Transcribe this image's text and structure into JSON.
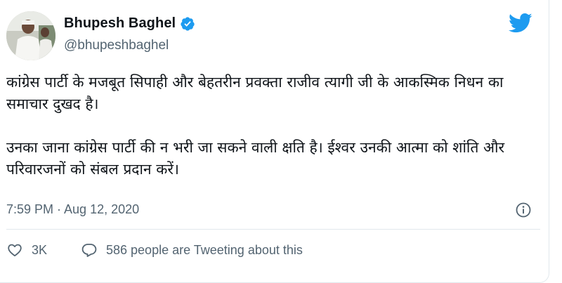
{
  "user": {
    "display_name": "Bhupesh Baghel",
    "handle": "@bhupeshbaghel",
    "verified": true
  },
  "tweet": {
    "paragraphs": [
      "कांग्रेस पार्टी के मजबूत सिपाही और बेहतरीन प्रवक्ता राजीव त्यागी जी के आकस्मिक निधन का समाचार दुखद है।",
      "उनका जाना कांग्रेस पार्टी की न भरी जा सकने वाली क्षति है। ईश्वर उनकी आत्मा को शांति और परिवारजनों को संबल प्रदान करें।"
    ],
    "timestamp": "7:59 PM · Aug 12, 2020"
  },
  "actions": {
    "like_count": "3K",
    "conversation_text": "586 people are Tweeting about this"
  },
  "icons": {
    "verified": "verified-badge-icon",
    "brand": "twitter-bird-icon",
    "info": "info-icon",
    "like": "heart-icon",
    "reply": "speech-bubble-icon"
  },
  "colors": {
    "brand_blue": "#1d9bf0",
    "text_primary": "#0f1419",
    "text_secondary": "#536471",
    "divider": "#e1e8ed"
  }
}
